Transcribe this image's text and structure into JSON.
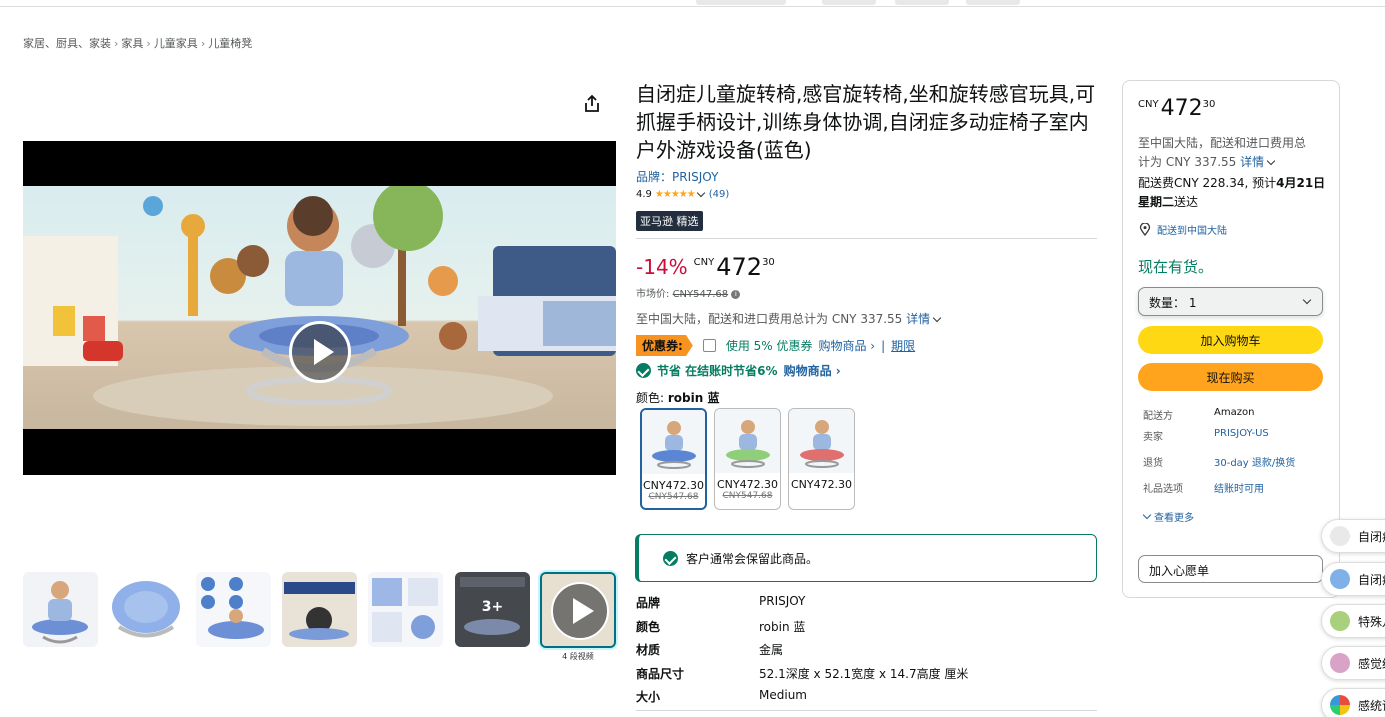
{
  "breadcrumb": [
    "家居、厨具、家装",
    "家具",
    "儿童家具",
    "儿童椅凳"
  ],
  "gallery": {
    "video_count_label": "4 段视频",
    "more_label": "3+"
  },
  "product": {
    "title": "自闭症儿童旋转椅,感官旋转椅,坐和旋转感官玩具,可抓握手柄设计,训练身体协调,自闭症多动症椅子室内户外游戏设备(蓝色)",
    "brand_label": "品牌：",
    "brand": "PRISJOY",
    "rating": "4.9",
    "stars": "★★★★★",
    "review_count": "(49)",
    "badge": "亚马逊 精选",
    "discount": "-14%",
    "currency": "CNY",
    "price_whole": "472",
    "price_fraction": "30",
    "market_label": "市场价:",
    "market_price": "CNY547.68",
    "import_text": "至中国大陆，配送和进口费用总计为 CNY 337.55",
    "details_link": "详情",
    "coupon_tag": "优惠券:",
    "coupon_text": "使用 5% 优惠券",
    "coupon_link": "购物商品 ›",
    "coupon_sep": "|",
    "coupon_terms": "期限",
    "save_text": "节省 在结账时节省6%",
    "save_link": "购物商品 ›",
    "color_label": "颜色:",
    "color_value": "robin 蓝",
    "swatches": [
      {
        "price": "CNY472.30",
        "strike": "CNY547.68",
        "color": "#5b86d4"
      },
      {
        "price": "CNY472.30",
        "strike": "CNY547.68",
        "color": "#8fcf7a"
      },
      {
        "price": "CNY472.30",
        "strike": "",
        "color": "#e07070"
      }
    ],
    "stock_note": "客户通常会保留此商品。",
    "specs": [
      {
        "k": "品牌",
        "v": "PRISJOY"
      },
      {
        "k": "颜色",
        "v": "robin 蓝"
      },
      {
        "k": "材质",
        "v": "金属"
      },
      {
        "k": "商品尺寸",
        "v": "52.1深度 x 52.1宽度 x 14.7高度 厘米"
      },
      {
        "k": "大小",
        "v": "Medium"
      }
    ]
  },
  "buybox": {
    "currency": "CNY",
    "price_whole": "472",
    "price_fraction": "30",
    "import_line1": "至中国大陆，配送和进口费用总",
    "import_line2": "计为 CNY 337.55",
    "details_link": "详情",
    "shipping_line1_a": "配送费CNY 228.34, 预计",
    "shipping_line1_b": "4月21日",
    "shipping_line2_a": "星期二",
    "shipping_line2_b": "送达",
    "deliver_to": "配送到中国大陆",
    "in_stock": "现在有货。",
    "qty_label": "数量：",
    "qty_value": "1",
    "add_to_cart": "加入购物车",
    "buy_now": "现在购买",
    "info": [
      {
        "k": "配送方",
        "v": "Amazon",
        "link": false
      },
      {
        "k": "卖家",
        "v": "PRISJOY-US",
        "link": true
      },
      {
        "k": "退货",
        "v": "30-day 退款/换货",
        "link": true
      },
      {
        "k": "礼品选项",
        "v": "结账时可用",
        "link": true
      }
    ],
    "see_more": "查看更多",
    "wishlist": "加入心愿单"
  },
  "side_panel": [
    "自闭症",
    "自闭症",
    "特殊儿",
    "感觉统",
    "感统训"
  ]
}
